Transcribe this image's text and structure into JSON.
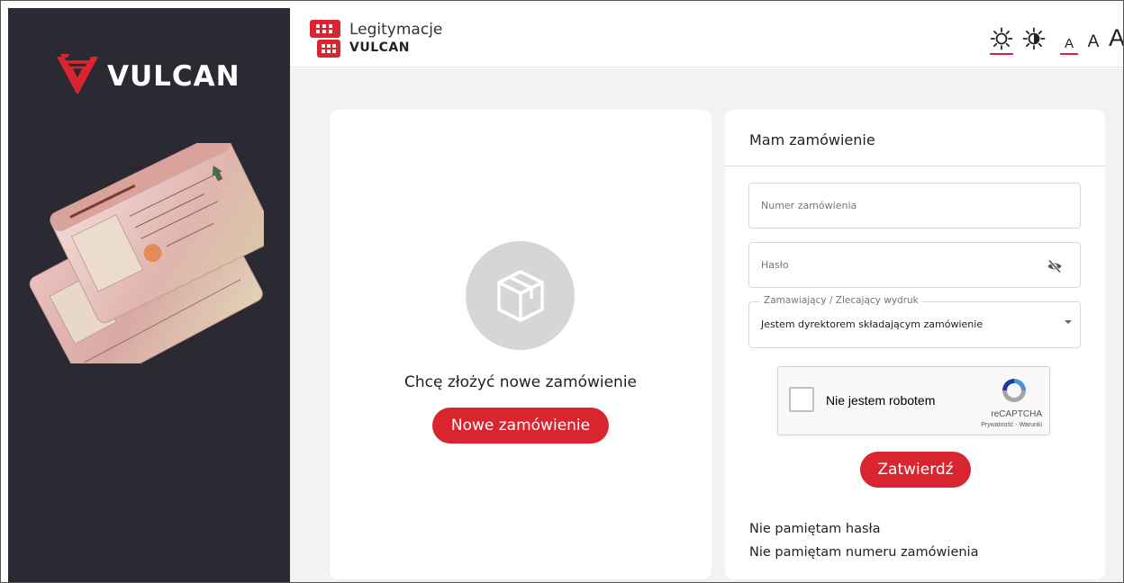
{
  "brand": {
    "name": "VULCAN",
    "color": "#d9252f"
  },
  "header": {
    "app_title_line1": "Legitymacje",
    "app_title_line2": "VULCAN",
    "contrast_tools": [
      {
        "icon": "brightness-icon",
        "active": true
      },
      {
        "icon": "high-contrast-icon",
        "active": false
      }
    ],
    "font_sizes": [
      {
        "label": "A",
        "size": "small",
        "active": true
      },
      {
        "label": "A",
        "size": "medium",
        "active": false
      },
      {
        "label": "A",
        "size": "large",
        "active": false
      }
    ]
  },
  "new_order": {
    "heading": "Chcę złożyć nowe zamówienie",
    "button_label": "Nowe zamówienie",
    "icon": "package-icon"
  },
  "login": {
    "title": "Mam zamówienie",
    "order_number_placeholder": "Numer zamówienia",
    "password_placeholder": "Hasło",
    "requester_label": "Zamawiający / Zlecający wydruk",
    "requester_value": "Jestem dyrektorem składającym zamówienie",
    "recaptcha_label": "Nie jestem robotem",
    "recaptcha_brand": "reCAPTCHA",
    "recaptcha_terms": "Prywatność - Warunki",
    "submit_label": "Zatwierdź",
    "forgot_password": "Nie pamiętam hasła",
    "forgot_order_number": "Nie pamiętam numeru zamówienia"
  },
  "colors": {
    "accent": "#d9252f",
    "sidebar_bg": "#2b2a33",
    "main_bg": "#f2f2f3"
  }
}
